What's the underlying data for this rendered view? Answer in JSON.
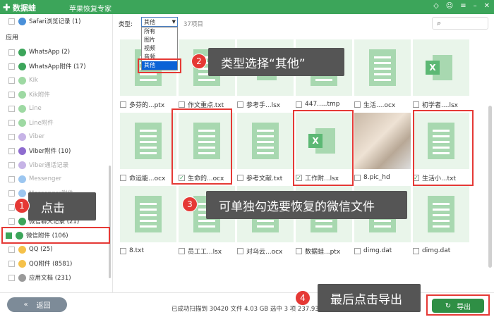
{
  "titlebar": {
    "brand": "数据蛙",
    "subtitle": "苹果恢复专家"
  },
  "sidebar": {
    "section_label": "应用",
    "items": [
      {
        "label": "Safari浏览记录 (1)",
        "dim": false,
        "checked": false,
        "color": "#4a90d9"
      },
      {
        "label": "WhatsApp (2)",
        "dim": false,
        "checked": false,
        "color": "#3ca55a"
      },
      {
        "label": "WhatsApp附件 (17)",
        "dim": false,
        "checked": false,
        "color": "#3ca55a"
      },
      {
        "label": "Kik",
        "dim": true,
        "checked": false,
        "color": "#9ed9a3"
      },
      {
        "label": "Kik附件",
        "dim": true,
        "checked": false,
        "color": "#9ed9a3"
      },
      {
        "label": "Line",
        "dim": true,
        "checked": false,
        "color": "#9ed9a3"
      },
      {
        "label": "Line附件",
        "dim": true,
        "checked": false,
        "color": "#9ed9a3"
      },
      {
        "label": "Viber",
        "dim": true,
        "checked": false,
        "color": "#c6b3e6"
      },
      {
        "label": "Viber附件 (10)",
        "dim": false,
        "checked": false,
        "color": "#8e6ccf"
      },
      {
        "label": "Viber通话记录",
        "dim": true,
        "checked": false,
        "color": "#c6b3e6"
      },
      {
        "label": "Messenger",
        "dim": true,
        "checked": false,
        "color": "#9cc6f0"
      },
      {
        "label": "Messenger附件",
        "dim": true,
        "checked": false,
        "color": "#9cc6f0"
      },
      {
        "label": "微信通讯录",
        "dim": false,
        "checked": false,
        "color": "#3ca55a"
      },
      {
        "label": "微信聊天记录 (21)",
        "dim": false,
        "checked": false,
        "color": "#3ca55a"
      },
      {
        "label": "微信附件 (106)",
        "dim": false,
        "checked": true,
        "color": "#3ca55a"
      },
      {
        "label": "QQ (25)",
        "dim": false,
        "checked": false,
        "color": "#f5c14a"
      },
      {
        "label": "QQ附件 (8581)",
        "dim": false,
        "checked": false,
        "color": "#f5c14a"
      },
      {
        "label": "应用文档 (231)",
        "dim": false,
        "checked": false,
        "color": "#9a9a9a"
      }
    ]
  },
  "filter": {
    "label": "类型:",
    "selected": "其他",
    "count": "37项目",
    "options": [
      "所有",
      "图片",
      "视频",
      "音频",
      "其他"
    ]
  },
  "files": [
    {
      "name": "多芬的...ptx",
      "icon": "doc",
      "checked": false
    },
    {
      "name": "作文重点.txt",
      "icon": "doc",
      "checked": false
    },
    {
      "name": "参考手...lsx",
      "icon": "xls",
      "checked": false
    },
    {
      "name": "447.....tmp",
      "icon": "doc",
      "checked": false
    },
    {
      "name": "生活....ocx",
      "icon": "doc",
      "checked": false
    },
    {
      "name": "初学者....lsx",
      "icon": "xls",
      "checked": false
    },
    {
      "name": "命运能...ocx",
      "icon": "doc",
      "checked": false
    },
    {
      "name": "生命的...ocx",
      "icon": "doc",
      "checked": true
    },
    {
      "name": "参考文献.txt",
      "icon": "doc",
      "checked": false
    },
    {
      "name": "工作附...lsx",
      "icon": "xls",
      "checked": true
    },
    {
      "name": "8.pic_hd",
      "icon": "photo",
      "checked": false
    },
    {
      "name": "生活小...txt",
      "icon": "doc",
      "checked": true
    },
    {
      "name": "8.txt",
      "icon": "doc",
      "checked": false
    },
    {
      "name": "员工工...lsx",
      "icon": "doc",
      "checked": false
    },
    {
      "name": "对乌云...ocx",
      "icon": "doc",
      "checked": false
    },
    {
      "name": "数据蛙...ptx",
      "icon": "doc",
      "checked": false
    },
    {
      "name": "dimg.dat",
      "icon": "doc",
      "checked": false
    },
    {
      "name": "dimg.dat",
      "icon": "doc",
      "checked": false
    }
  ],
  "callouts": [
    {
      "num": "1",
      "text": "点击"
    },
    {
      "num": "2",
      "text": "类型选择“其他”"
    },
    {
      "num": "3",
      "text": "可单独勾选要恢复的微信文件"
    },
    {
      "num": "4",
      "text": "最后点击导出"
    }
  ],
  "bottom": {
    "back": "返回",
    "status": "已成功扫描到 30420 文件 4.03 GB   选中 3 项 237.93 KB",
    "export": "导出"
  }
}
